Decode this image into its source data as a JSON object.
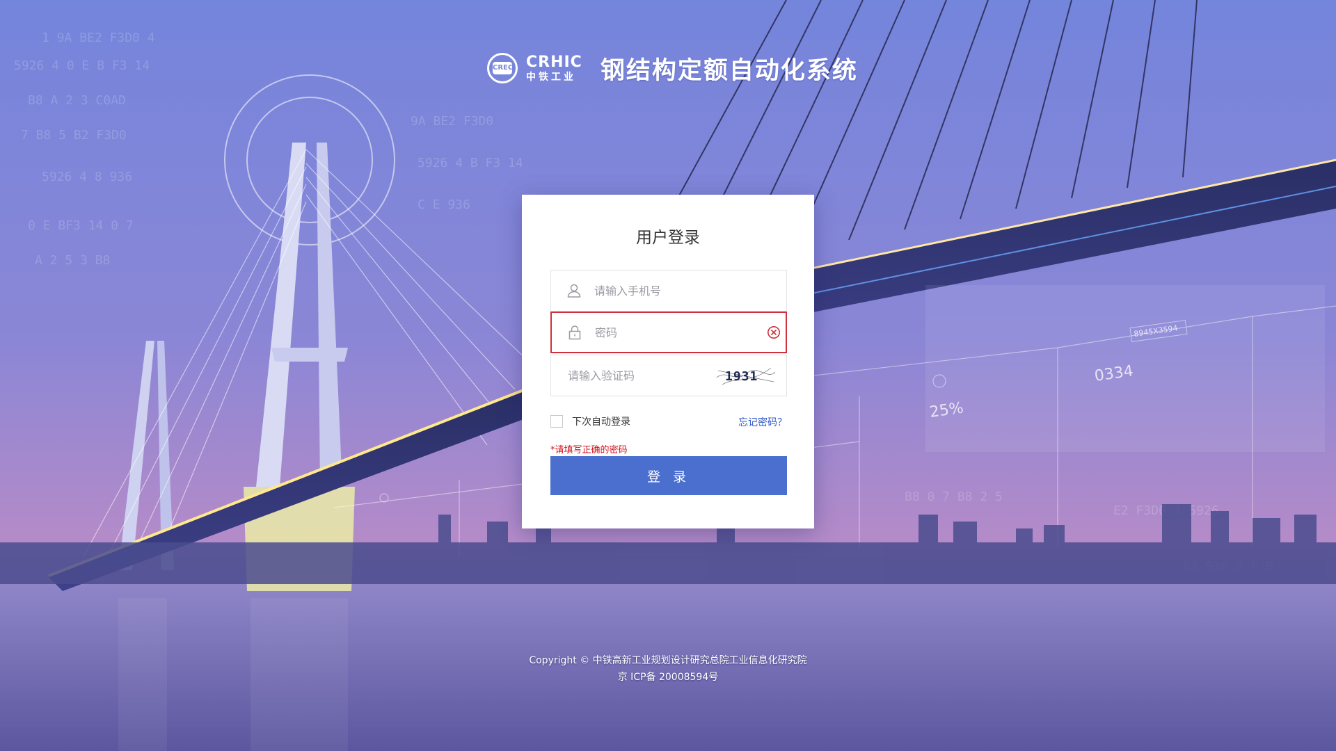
{
  "brand": {
    "logo_mark": "CREC",
    "logo_en": "CRHIC",
    "logo_cn": "中铁工业",
    "system_title": "钢结构定额自动化系统"
  },
  "login": {
    "title": "用户登录",
    "phone_placeholder": "请输入手机号",
    "password_placeholder": "密码",
    "captcha_placeholder": "请输入验证码",
    "captcha_code": "1931",
    "remember_label": "下次自动登录",
    "forgot_label": "忘记密码？",
    "error_message": "*请填写正确的密码",
    "submit_label": "登 录"
  },
  "decor": {
    "hud_percent": "25%",
    "hud_number": "0334",
    "hud_tag": "8945X3594"
  },
  "footer": {
    "copyright": "Copyright © 中铁高新工业规划设计研究总院工业信息化研究院",
    "icp": "京 ICP备 20008594号"
  },
  "colors": {
    "accent": "#4a6fcf",
    "error": "#d0303b",
    "link": "#2f56c9"
  }
}
